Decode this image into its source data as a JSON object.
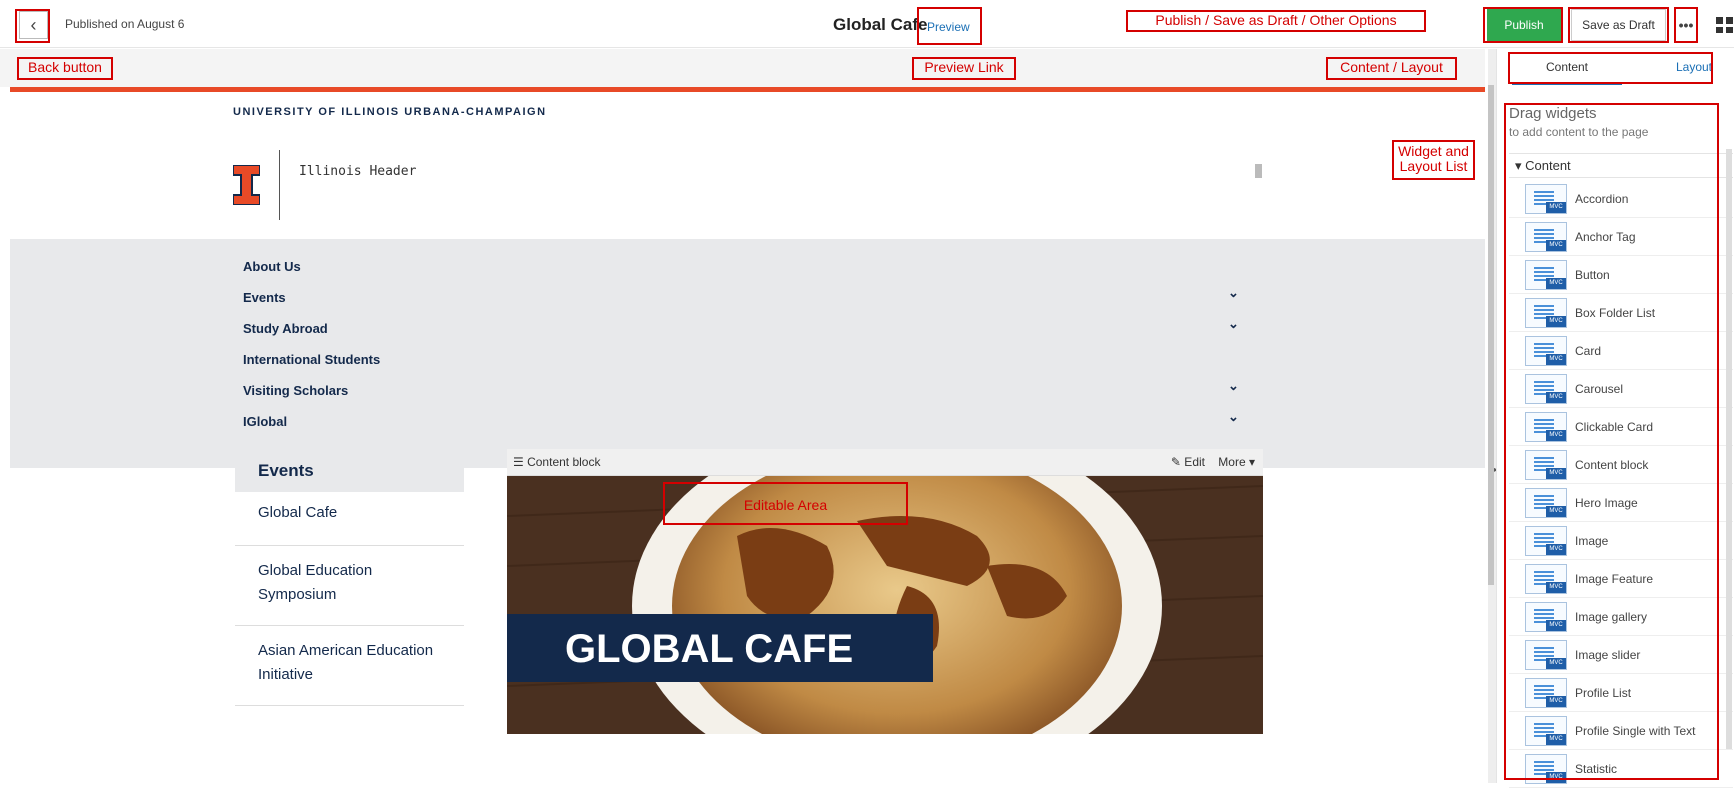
{
  "topbar": {
    "back_glyph": "‹",
    "published": "Published on August 6",
    "title": "Global Cafe",
    "preview": "Preview",
    "publish": "Publish",
    "save_draft": "Save as Draft",
    "more": "•••"
  },
  "page": {
    "university": "UNIVERSITY OF ILLINOIS URBANA-CHAMPAIGN",
    "header_text": "Illinois Header",
    "nav": [
      {
        "label": "About Us",
        "chevron": ""
      },
      {
        "label": "Events",
        "chevron": "⌄"
      },
      {
        "label": "Study Abroad",
        "chevron": "⌄"
      },
      {
        "label": "International Students",
        "chevron": ""
      },
      {
        "label": "Visiting Scholars",
        "chevron": "⌄"
      },
      {
        "label": "IGlobal",
        "chevron": "⌄"
      }
    ],
    "left_nav": {
      "heading": "Events",
      "links": [
        "Global Cafe",
        "Global Education Symposium",
        "Asian American Education Initiative"
      ]
    },
    "content_block": {
      "label": "☰ Content block",
      "edit": "✎ Edit",
      "more": "More ▾",
      "hero_title": "GLOBAL CAFE"
    }
  },
  "panel": {
    "tab_content": "Content",
    "tab_layout": "Layout",
    "drag_title": "Drag widgets",
    "drag_sub": "to add content to the page",
    "section": "▾ Content",
    "badge": "MVC",
    "widgets": [
      "Accordion",
      "Anchor Tag",
      "Button",
      "Box Folder List",
      "Card",
      "Carousel",
      "Clickable Card",
      "Content block",
      "Hero Image",
      "Image",
      "Image Feature",
      "Image gallery",
      "Image slider",
      "Profile List",
      "Profile Single with Text",
      "Statistic"
    ]
  },
  "annotations": {
    "back": "Back button",
    "preview_link": "Preview Link",
    "publish_opts": "Publish / Save as Draft / Other Options",
    "content_layout": "Content / Layout",
    "widget_list": "Widget and\nLayout List",
    "editable": "Editable Area"
  },
  "colors": {
    "accent_orange": "#e84a27",
    "navy": "#13294b",
    "publish_green": "#2fa84f",
    "annotation_red": "#d40000"
  }
}
